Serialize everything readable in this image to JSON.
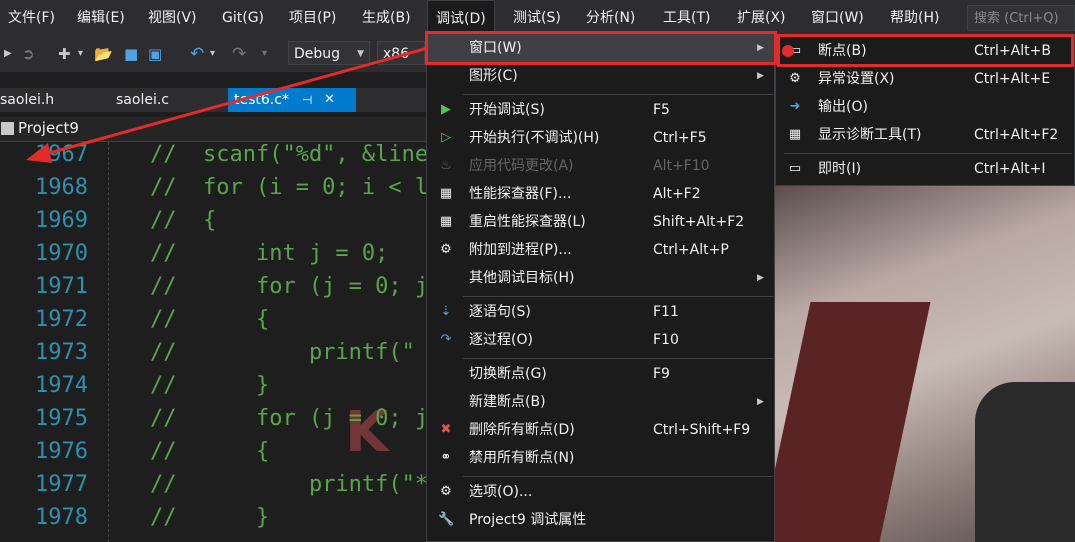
{
  "menubar": {
    "items": [
      "文件(F)",
      "编辑(E)",
      "视图(V)",
      "Git(G)",
      "项目(P)",
      "生成(B)",
      "调试(D)",
      "测试(S)",
      "分析(N)",
      "工具(T)",
      "扩展(X)",
      "窗口(W)",
      "帮助(H)"
    ],
    "search_placeholder": "搜索 (Ctrl+Q)"
  },
  "toolbar": {
    "config": "Debug",
    "platform": "x86"
  },
  "tabs": [
    "saolei.h",
    "saolei.c",
    "test6.c*"
  ],
  "tab_pin": "⊣",
  "tab_close": "✕",
  "nav": {
    "project": "Project9"
  },
  "editor": {
    "lines": [
      {
        "num": "1967",
        "code": "//  scanf(\"%d\", &line"
      },
      {
        "num": "1968",
        "code": "//  for (i = 0; i < l"
      },
      {
        "num": "1969",
        "code": "//  {"
      },
      {
        "num": "1970",
        "code": "//      int j = 0;"
      },
      {
        "num": "1971",
        "code": "//      for (j = 0; j"
      },
      {
        "num": "1972",
        "code": "//      {"
      },
      {
        "num": "1973",
        "code": "//          printf(\""
      },
      {
        "num": "1974",
        "code": "//      }"
      },
      {
        "num": "1975",
        "code": "//      for (j = 0; j"
      },
      {
        "num": "1976",
        "code": "//      {"
      },
      {
        "num": "1977",
        "code": "//          printf(\"*"
      },
      {
        "num": "1978",
        "code": "//      }"
      }
    ]
  },
  "debug_menu": {
    "items": [
      {
        "label": "窗口(W)",
        "shortcut": "",
        "icon": "",
        "submenu": true,
        "highlight": true
      },
      {
        "label": "图形(C)",
        "shortcut": "",
        "icon": "",
        "submenu": true
      },
      {
        "label": "开始调试(S)",
        "shortcut": "F5",
        "icon": "play-icon"
      },
      {
        "label": "开始执行(不调试)(H)",
        "shortcut": "Ctrl+F5",
        "icon": "play-outline-icon"
      },
      {
        "label": "应用代码更改(A)",
        "shortcut": "Alt+F10",
        "icon": "flame-icon",
        "disabled": true
      },
      {
        "label": "性能探查器(F)...",
        "shortcut": "Alt+F2",
        "icon": "profiler-icon"
      },
      {
        "label": "重启性能探查器(L)",
        "shortcut": "Shift+Alt+F2",
        "icon": "profiler-icon"
      },
      {
        "label": "附加到进程(P)...",
        "shortcut": "Ctrl+Alt+P",
        "icon": "gears-icon"
      },
      {
        "label": "其他调试目标(H)",
        "shortcut": "",
        "icon": "",
        "submenu": true
      },
      {
        "label": "逐语句(S)",
        "shortcut": "F11",
        "icon": "step-into-icon"
      },
      {
        "label": "逐过程(O)",
        "shortcut": "F10",
        "icon": "step-over-icon"
      },
      {
        "label": "切换断点(G)",
        "shortcut": "F9",
        "icon": ""
      },
      {
        "label": "新建断点(B)",
        "shortcut": "",
        "icon": "",
        "submenu": true
      },
      {
        "label": "删除所有断点(D)",
        "shortcut": "Ctrl+Shift+F9",
        "icon": "delete-breakpoints-icon"
      },
      {
        "label": "禁用所有断点(N)",
        "shortcut": "",
        "icon": "disable-breakpoints-icon"
      },
      {
        "label": "选项(O)...",
        "shortcut": "",
        "icon": "gear-icon"
      },
      {
        "label": "Project9 调试属性",
        "shortcut": "",
        "icon": "wrench-icon"
      }
    ]
  },
  "windows_submenu": {
    "items": [
      {
        "label": "断点(B)",
        "shortcut": "Ctrl+Alt+B",
        "icon": "breakpoint-window-icon"
      },
      {
        "label": "异常设置(X)",
        "shortcut": "Ctrl+Alt+E",
        "icon": "exception-icon"
      },
      {
        "label": "输出(O)",
        "shortcut": "",
        "icon": "output-icon"
      },
      {
        "label": "显示诊断工具(T)",
        "shortcut": "Ctrl+Alt+F2",
        "icon": "diagnostics-icon"
      },
      {
        "label": "即时(I)",
        "shortcut": "Ctrl+Alt+I",
        "icon": "immediate-icon"
      }
    ]
  },
  "colors": {
    "accent": "#007acc",
    "annotation": "#e32b2b",
    "comment": "#57a64a",
    "line_number": "#2b91af"
  }
}
